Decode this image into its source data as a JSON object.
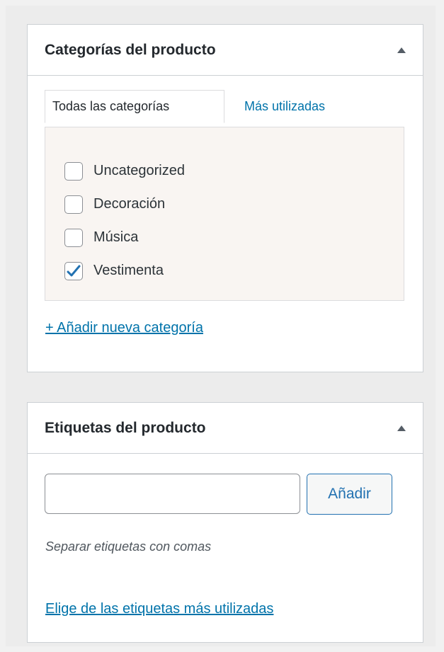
{
  "categories_box": {
    "title": "Categorías del producto",
    "tabs": [
      {
        "label": "Todas las categorías",
        "active": true
      },
      {
        "label": "Más utilizadas",
        "active": false
      }
    ],
    "items": [
      {
        "label": "Uncategorized",
        "checked": false
      },
      {
        "label": "Decoración",
        "checked": false
      },
      {
        "label": "Música",
        "checked": false
      },
      {
        "label": "Vestimenta",
        "checked": true
      }
    ],
    "add_link": "+ Añadir nueva categoría",
    "toggle_icon": "triangle-up-icon"
  },
  "tags_box": {
    "title": "Etiquetas del producto",
    "input_value": "",
    "input_placeholder": "",
    "add_button": "Añadir",
    "hint": "Separar etiquetas con comas",
    "choose_link": "Elige de las etiquetas más utilizadas",
    "toggle_icon": "triangle-up-icon"
  },
  "colors": {
    "link": "#0073aa",
    "border": "#ccd0d4",
    "checkbox_checked": "#2271b1"
  }
}
